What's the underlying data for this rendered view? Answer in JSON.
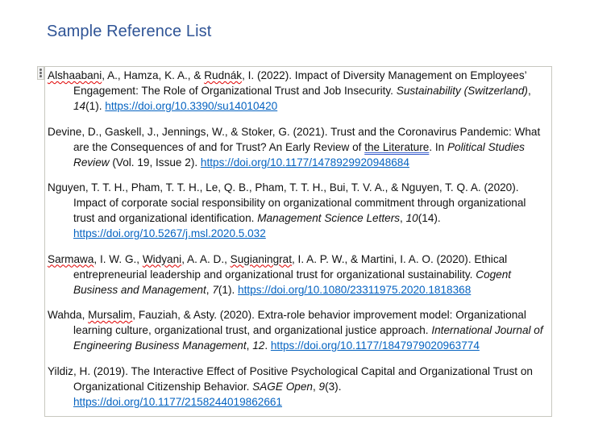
{
  "document": {
    "title": "Sample Reference List"
  },
  "icons": {
    "drag_handle": "drag-handle-icon"
  },
  "colors": {
    "title": "#2f5496",
    "link": "#0563c1",
    "spellcheck": "#e00000",
    "grammarcheck": "#3a5fcd",
    "box_border": "#c8c8c0"
  },
  "references": [
    {
      "authors_flagged": "Alshaabani",
      "authors_rest_1": ", A., Hamza, K. A., & ",
      "authors_flagged_2": "Rudnák",
      "body": ", I. (2022). Impact of Diversity Management on Employees’ Engagement: The Role of Organizational Trust and Job Insecurity. ",
      "journal": "Sustainability (Switzerland)",
      "sep": ", ",
      "volume": "14",
      "issue": "(1). ",
      "doi": "https://doi.org/10.3390/su14010420"
    },
    {
      "text_1": "Devine, D., Gaskell, J., Jennings, W., & Stoker, G. (2021). Trust and the Coronavirus Pandemic: What are the Consequences of and for Trust? An Early Review of ",
      "grammar_flagged": "the Literature",
      "text_2": ". In ",
      "journal": "Political Studies Review",
      "text_3": " (Vol. 19, Issue 2). ",
      "doi": "https://doi.org/10.1177/1478929920948684"
    },
    {
      "text_1": "Nguyen, T. T. H., Pham, T. T. H., Le, Q. B., Pham, T. T. H., Bui, T. V. A., & Nguyen, T. Q. A. (2020). Impact of corporate social responsibility on organizational commitment through organizational trust and organizational identification. ",
      "journal": "Management Science Letters",
      "sep": ", ",
      "volume": "10",
      "issue": "(14). ",
      "doi": "https://doi.org/10.5267/j.msl.2020.5.032"
    },
    {
      "flagged_1": "Sarmawa",
      "text_1": ", I. W. G., ",
      "flagged_2": "Widyani",
      "text_2": ", A. A. D., ",
      "flagged_3": "Sugianingrat",
      "text_3": ", I. A. P. W., & Martini, I. A. O. (2020). Ethical entrepreneurial leadership and organizational trust for organizational sustainability. ",
      "journal": "Cogent Business and Management",
      "sep": ", ",
      "volume": "7",
      "issue": "(1). ",
      "doi": "https://doi.org/10.1080/23311975.2020.1818368"
    },
    {
      "text_1": "Wahda, ",
      "flagged_1": "Mursalim",
      "text_2": ", Fauziah, & Asty. (2020). Extra-role behavior improvement model: Organizational learning culture, organizational trust, and organizational justice approach. ",
      "journal": "International Journal of Engineering Business Management",
      "sep": ", ",
      "volume": "12",
      "issue": ". ",
      "doi": "https://doi.org/10.1177/1847979020963774"
    },
    {
      "text_1": "Yildiz, H. (2019). The Interactive Effect of Positive Psychological Capital and Organizational Trust on Organizational Citizenship Behavior. ",
      "journal": "SAGE Open",
      "sep": ", ",
      "volume": "9",
      "issue": "(3). ",
      "doi": "https://doi.org/10.1177/2158244019862661"
    }
  ]
}
